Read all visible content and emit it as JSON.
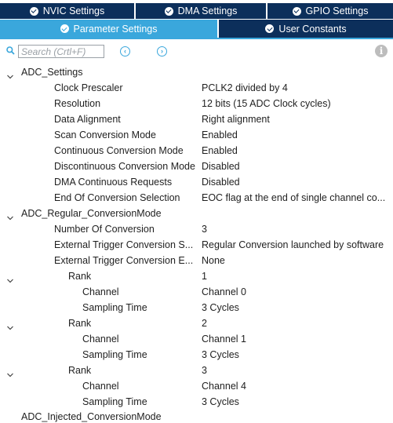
{
  "tabs_row1": [
    {
      "label": "NVIC Settings",
      "active": false
    },
    {
      "label": "DMA Settings",
      "active": false
    },
    {
      "label": "GPIO Settings",
      "active": false
    }
  ],
  "tabs_row2": [
    {
      "label": "Parameter Settings",
      "active": true
    },
    {
      "label": "User Constants",
      "active": false
    }
  ],
  "search": {
    "placeholder": "Search (Crtl+F)"
  },
  "icons": {
    "search": "search-icon",
    "prev": "chevron-left-icon",
    "next": "chevron-right-icon",
    "info": "info-icon"
  },
  "colors": {
    "tab_bg": "#0c2f5b",
    "tab_active": "#3aa7dc"
  },
  "tree": [
    {
      "type": "group",
      "label": "ADC_Settings",
      "expanded": true
    },
    {
      "type": "param",
      "label": "Clock Prescaler",
      "value": "PCLK2 divided by 4"
    },
    {
      "type": "param",
      "label": "Resolution",
      "value": "12 bits (15 ADC Clock cycles)"
    },
    {
      "type": "param",
      "label": "Data Alignment",
      "value": "Right alignment"
    },
    {
      "type": "param",
      "label": "Scan Conversion Mode",
      "value": "Enabled"
    },
    {
      "type": "param",
      "label": "Continuous Conversion Mode",
      "value": "Enabled"
    },
    {
      "type": "param",
      "label": "Discontinuous Conversion Mode",
      "value": "Disabled"
    },
    {
      "type": "param",
      "label": "DMA Continuous Requests",
      "value": "Disabled"
    },
    {
      "type": "param",
      "label": "End Of Conversion Selection",
      "value": "EOC flag at the end of single channel co..."
    },
    {
      "type": "group",
      "label": "ADC_Regular_ConversionMode",
      "expanded": true
    },
    {
      "type": "param",
      "label": "Number Of Conversion",
      "value": "3"
    },
    {
      "type": "param",
      "label": "External Trigger Conversion S...",
      "value": "Regular Conversion launched by software"
    },
    {
      "type": "param",
      "label": "External Trigger Conversion E...",
      "value": "None"
    },
    {
      "type": "rank",
      "label": "Rank",
      "value": "1",
      "expanded": true
    },
    {
      "type": "sub",
      "label": "Channel",
      "value": "Channel 0"
    },
    {
      "type": "sub",
      "label": "Sampling Time",
      "value": "3 Cycles"
    },
    {
      "type": "rank",
      "label": "Rank",
      "value": "2",
      "expanded": true
    },
    {
      "type": "sub",
      "label": "Channel",
      "value": "Channel 1"
    },
    {
      "type": "sub",
      "label": "Sampling Time",
      "value": "3 Cycles"
    },
    {
      "type": "rank",
      "label": "Rank",
      "value": "3",
      "expanded": true
    },
    {
      "type": "sub",
      "label": "Channel",
      "value": "Channel 4"
    },
    {
      "type": "sub",
      "label": "Sampling Time",
      "value": "3 Cycles"
    }
  ],
  "cut_off_group": "ADC_Injected_ConversionMode"
}
